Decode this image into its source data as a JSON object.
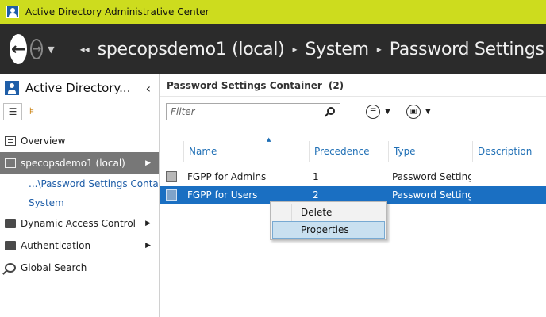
{
  "window": {
    "title": "Active Directory Administrative Center"
  },
  "nav": {
    "breadcrumbs": [
      "specopsdemo1 (local)",
      "System",
      "Password Settings C"
    ]
  },
  "left_pane": {
    "title": "Active Directory...",
    "items": [
      {
        "label": "Overview"
      },
      {
        "label": "specopsdemo1 (local)"
      },
      {
        "label": "...\\Password Settings Contai..."
      },
      {
        "label": "System"
      },
      {
        "label": "Dynamic Access Control"
      },
      {
        "label": "Authentication"
      },
      {
        "label": "Global Search"
      }
    ]
  },
  "main": {
    "header_title": "Password Settings Container",
    "header_count": "(2)",
    "filter_placeholder": "Filter",
    "columns": [
      "Name",
      "Precedence",
      "Type",
      "Description"
    ],
    "rows": [
      {
        "name": "FGPP for Admins",
        "precedence": "1",
        "type": "Password Settings",
        "description": ""
      },
      {
        "name": "FGPP for Users",
        "precedence": "2",
        "type": "Password Settings",
        "description": ""
      }
    ]
  },
  "context_menu": {
    "items": [
      "Delete",
      "Properties"
    ]
  },
  "colors": {
    "titlebar": "#cddc1e",
    "navbar": "#2b2b2b",
    "selection": "#1a6fc2",
    "menu_hover": "#c9e0f0"
  }
}
